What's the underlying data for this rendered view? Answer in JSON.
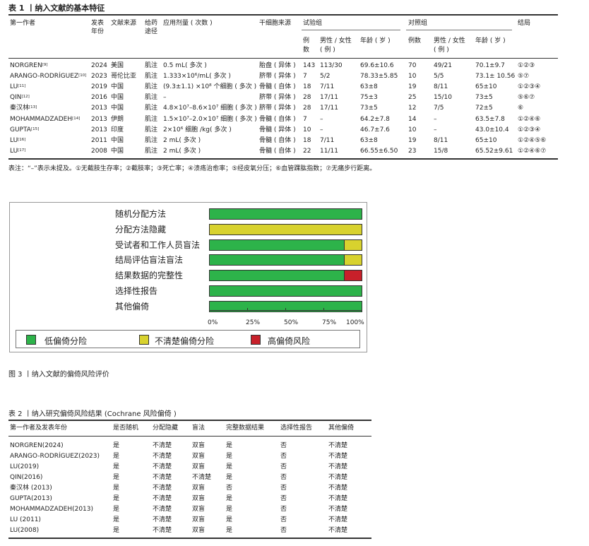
{
  "table1": {
    "title": "表 1 丨纳入文献的基本特征",
    "headers": {
      "author": "第一作者",
      "year": "发表",
      "year2": "年份",
      "source": "文献来源",
      "route": "给药",
      "route2": "途径",
      "dose": "应用剂量 ( 次数 )",
      "stem": "干细胞来源",
      "trial": "试验组",
      "control": "对照组",
      "outcome": "结局",
      "n": "例",
      "n2": "数",
      "sex": "男性 / 女性",
      "sex2": "( 例 )",
      "age": "年龄 ( 岁 )",
      "cn": "例数",
      "csex": "男性 / 女性",
      "csex2": "( 例 )",
      "cage": "年龄 ( 岁 )"
    },
    "rows": [
      {
        "author": "NORGREN",
        "ref": "[9]",
        "year": "2024",
        "source": "美国",
        "route": "肌注",
        "dose": "0.5 mL( 多次 )",
        "stem": "胎盘 ( 异体 )",
        "tn": "143",
        "tsex": "113/30",
        "tage": "69.6±10.6",
        "cn": "70",
        "csex": "49/21",
        "cage": "70.1±9.7",
        "outcome": "①②③"
      },
      {
        "author": "ARANGO-RODRÍGUEZ",
        "ref": "[10]",
        "year": "2023",
        "source": "哥伦比亚",
        "route": "肌注",
        "dose": "1.333×10⁶/mL( 多次 )",
        "stem": "脐带 ( 异体 )",
        "tn": "7",
        "tsex": "5/2",
        "tage": "78.33±5.85",
        "cn": "10",
        "csex": "5/5",
        "cage": "73.1± 10.56",
        "outcome": "⑤⑦"
      },
      {
        "author": "LU",
        "ref": "[11]",
        "year": "2019",
        "source": "中国",
        "route": "肌注",
        "dose": "(9.3±1.1) ×10⁸ 个细胞 ( 多次 )",
        "stem": "骨髓 ( 自体 )",
        "tn": "18",
        "tsex": "7/11",
        "tage": "63±8",
        "cn": "19",
        "csex": "8/11",
        "cage": "65±10",
        "outcome": "①②③④"
      },
      {
        "author": "QIN",
        "ref": "[12]",
        "year": "2016",
        "source": "中国",
        "route": "肌注",
        "dose": "–",
        "stem": "脐带 ( 异体 )",
        "tn": "28",
        "tsex": "17/11",
        "tage": "75±3",
        "cn": "25",
        "csex": "15/10",
        "cage": "73±5",
        "outcome": "⑤⑥⑦"
      },
      {
        "author": "秦汉林",
        "ref": "[13]",
        "year": "2013",
        "source": "中国",
        "route": "肌注",
        "dose": "4.8×10⁷–8.6×10⁷ 细胞 ( 多次 )",
        "stem": "脐带 ( 异体 )",
        "tn": "28",
        "tsex": "17/11",
        "tage": "73±5",
        "cn": "12",
        "csex": "7/5",
        "cage": "72±5",
        "outcome": "⑥"
      },
      {
        "author": "MOHAMMADZADEH",
        "ref": "[14]",
        "year": "2013",
        "source": "伊朗",
        "route": "肌注",
        "dose": "1.5×10⁷–2.0×10⁷ 细胞 ( 多次 )",
        "stem": "骨髓 ( 自体 )",
        "tn": "7",
        "tsex": "–",
        "tage": "64.2±7.8",
        "cn": "14",
        "csex": "–",
        "cage": "63.5±7.8",
        "outcome": "①②④⑥"
      },
      {
        "author": "GUPTA",
        "ref": "[15]",
        "year": "2013",
        "source": "印度",
        "route": "肌注",
        "dose": "2×10⁶ 细胞 /kg( 多次 )",
        "stem": "骨髓 ( 异体 )",
        "tn": "10",
        "tsex": "–",
        "tage": "46.7±7.6",
        "cn": "10",
        "csex": "–",
        "cage": "43.0±10.4",
        "outcome": "①②③④"
      },
      {
        "author": "LU",
        "ref": "[16]",
        "year": "2011",
        "source": "中国",
        "route": "肌注",
        "dose": "2 mL( 多次 )",
        "stem": "骨髓 ( 自体 )",
        "tn": "18",
        "tsex": "7/11",
        "tage": "63±8",
        "cn": "19",
        "csex": "8/11",
        "cage": "65±10",
        "outcome": "①②④⑤⑥"
      },
      {
        "author": "LU",
        "ref": "[17]",
        "year": "2008",
        "source": "中国",
        "route": "肌注",
        "dose": "2 mL( 多次 )",
        "stem": "骨髓 ( 自体 )",
        "tn": "22",
        "tsex": "11/11",
        "tage": "66.55±6.50",
        "cn": "23",
        "csex": "15/8",
        "cage": "65.52±9.61",
        "outcome": "①②④⑥⑦"
      }
    ],
    "note": "表注：“–”表示未提及。①无截肢生存率；②截肢率；③死亡率；④溃疡治愈率；⑤经皮氧分压；⑥血管踝肱指数；⑦无痛步行距离。"
  },
  "figure3": {
    "caption": "图 3 丨纳入文献的偏倚风险评价",
    "colors": {
      "low": "#2db34a",
      "unclear": "#d8d22e",
      "high": "#c8202a"
    },
    "legend": {
      "low": "低偏倚分险",
      "unclear": "不清楚偏倚分险",
      "high": "高偏倚风险"
    },
    "ticks": [
      "0%",
      "25%",
      "50%",
      "75%",
      "100%"
    ]
  },
  "chart_data": {
    "type": "bar",
    "stacked": true,
    "orientation": "horizontal",
    "categories": [
      "随机分配方法",
      "分配方法隐藏",
      "受试者和工作人员盲法",
      "结局评估盲法盲法",
      "结果数据的完整性",
      "选择性报告",
      "其他偏倚"
    ],
    "series": [
      {
        "name": "低偏倚分险",
        "values": [
          100,
          0,
          89,
          89,
          89,
          100,
          100
        ]
      },
      {
        "name": "不清楚偏倚分险",
        "values": [
          0,
          100,
          11,
          11,
          0,
          0,
          0
        ]
      },
      {
        "name": "高偏倚风险",
        "values": [
          0,
          0,
          0,
          0,
          11,
          0,
          0
        ]
      }
    ],
    "xlim": [
      0,
      100
    ],
    "xticks": [
      "0%",
      "25%",
      "50%",
      "75%",
      "100%"
    ],
    "legend_position": "bottom"
  },
  "table2": {
    "title": "表 2 丨纳入研究偏倚风险结果 (Cochrane 风险偏倚 )",
    "headers": [
      "第一作者及发表年份",
      "是否随机",
      "分配隐藏",
      "盲法",
      "完整数据结果",
      "选择性报告",
      "其他偏倚"
    ],
    "rows": [
      [
        "NORGREN(2024)",
        "是",
        "不清楚",
        "双盲",
        "是",
        "否",
        "不清楚"
      ],
      [
        "ARANGO-RODRÍGUEZ(2023)",
        "是",
        "不清楚",
        "双盲",
        "是",
        "否",
        "不清楚"
      ],
      [
        "LU(2019)",
        "是",
        "不清楚",
        "双盲",
        "是",
        "否",
        "不清楚"
      ],
      [
        "QIN(2016)",
        "是",
        "不清楚",
        "不清楚",
        "是",
        "否",
        "不清楚"
      ],
      [
        "秦汉林 (2013)",
        "是",
        "不清楚",
        "双盲",
        "否",
        "否",
        "不清楚"
      ],
      [
        "GUPTA(2013)",
        "是",
        "不清楚",
        "双盲",
        "是",
        "否",
        "不清楚"
      ],
      [
        "MOHAMMADZADEH(2013)",
        "是",
        "不清楚",
        "双盲",
        "是",
        "否",
        "不清楚"
      ],
      [
        "LU (2011)",
        "是",
        "不清楚",
        "双盲",
        "是",
        "否",
        "不清楚"
      ],
      [
        "LU(2008)",
        "是",
        "不清楚",
        "双盲",
        "是",
        "否",
        "不清楚"
      ]
    ]
  }
}
